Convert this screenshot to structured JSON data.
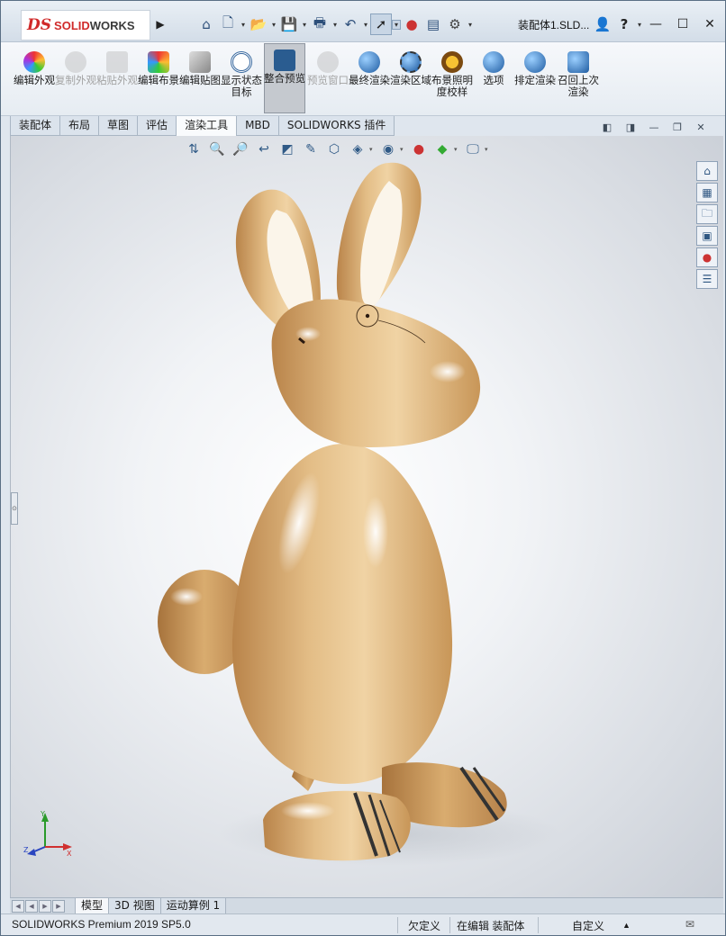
{
  "app": {
    "logo_ds": "DS",
    "logo_brand_a": "SOLID",
    "logo_brand_b": "WORKS",
    "doc_title": "装配体1.SLD..."
  },
  "quick_access": {
    "icons": [
      "home-icon",
      "new-document-icon",
      "open-folder-icon",
      "save-icon",
      "print-icon",
      "undo-icon",
      "select-pointer-icon",
      "rebuild-traffic-light-icon",
      "file-properties-icon",
      "options-gear-icon"
    ],
    "user_icon": "user-icon",
    "help_label": "?"
  },
  "window_controls": {
    "minimize": "—",
    "maximize": "☐",
    "close": "✕"
  },
  "command_manager": {
    "buttons": [
      {
        "label": "编辑外观",
        "icon": "edit-appearance-icon",
        "enabled": true
      },
      {
        "label": "复制外观",
        "icon": "copy-appearance-icon",
        "enabled": false
      },
      {
        "label": "粘贴外观",
        "icon": "paste-appearance-icon",
        "enabled": false
      },
      {
        "label": "编辑布景",
        "icon": "edit-scene-icon",
        "enabled": true
      },
      {
        "label": "编辑贴图",
        "icon": "edit-decal-icon",
        "enabled": true
      },
      {
        "label": "显示状态目标",
        "icon": "display-state-target-icon",
        "enabled": true
      },
      {
        "label": "整合预览",
        "icon": "integrated-preview-icon",
        "enabled": true,
        "active": true
      },
      {
        "label": "预览窗口",
        "icon": "preview-window-icon",
        "enabled": false
      },
      {
        "label": "最终渲染",
        "icon": "final-render-icon",
        "enabled": true
      },
      {
        "label": "渲染区域",
        "icon": "render-region-icon",
        "enabled": true
      },
      {
        "label": "布景照明度校样",
        "icon": "scene-illumination-proof-icon",
        "enabled": true
      },
      {
        "label": "选项",
        "icon": "render-options-icon",
        "enabled": true
      },
      {
        "label": "排定渲染",
        "icon": "schedule-render-icon",
        "enabled": true
      },
      {
        "label": "召回上次渲染",
        "icon": "recall-last-render-icon",
        "enabled": true
      }
    ]
  },
  "tabs": [
    {
      "label": "装配体"
    },
    {
      "label": "布局"
    },
    {
      "label": "草图"
    },
    {
      "label": "评估"
    },
    {
      "label": "渲染工具",
      "active": true
    },
    {
      "label": "MBD"
    },
    {
      "label": "SOLIDWORKS 插件"
    }
  ],
  "heads_up_toolbar": {
    "icons": [
      "view-orientation-icon",
      "zoom-to-fit-icon",
      "zoom-to-area-icon",
      "previous-view-icon",
      "section-view-icon",
      "dynamic-annotation-icon",
      "view-cube-icon",
      "display-style-icon",
      "hide-show-icon",
      "edit-appearance-icon",
      "apply-scene-icon",
      "view-settings-icon"
    ]
  },
  "task_pane": {
    "icons": [
      "solidworks-resources-icon",
      "design-library-icon",
      "file-explorer-icon",
      "view-palette-icon",
      "appearances-scenes-icon",
      "custom-properties-icon"
    ]
  },
  "bottom_tabs": [
    {
      "label": "模型",
      "active": true
    },
    {
      "label": "3D 视图"
    },
    {
      "label": "运动算例 1"
    }
  ],
  "status_bar": {
    "product": "SOLIDWORKS Premium 2019 SP5.0",
    "definition": "欠定义",
    "editing": "在编辑 装配体",
    "units": "自定义",
    "units_arrow": "▲"
  },
  "triad_axes": {
    "x": "X",
    "y": "Y",
    "z": "Z"
  },
  "colors": {
    "wood_light": "#f0d4a3",
    "wood_mid": "#d8aa6a",
    "wood_dark": "#b27c3e",
    "brand_red": "#d02a2a"
  }
}
